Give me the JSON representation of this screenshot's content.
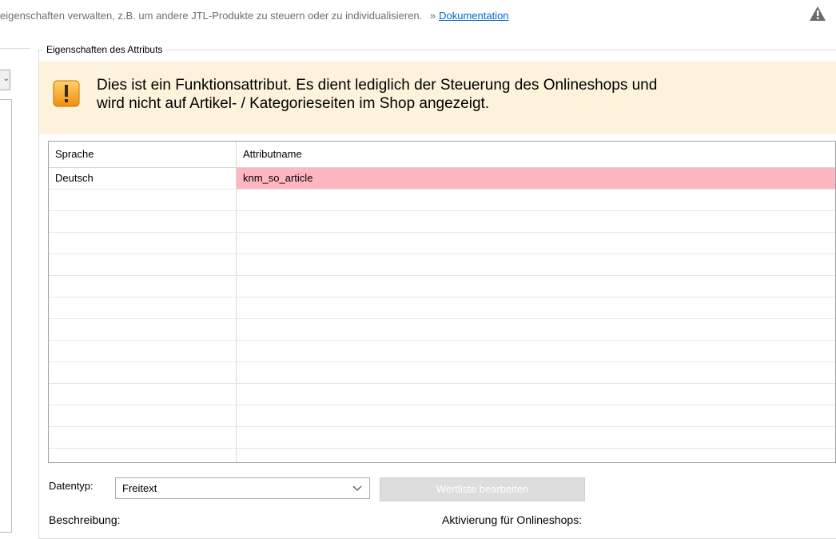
{
  "top": {
    "info_text": "eigenschaften verwalten, z.B. um andere JTL-Produkte zu steuern oder zu individualisieren.",
    "link_prefix": "»",
    "link_label": "Dokumentation",
    "warning_icon": "warning-triangle-icon"
  },
  "left": {
    "dropdown_glyph": "⌄"
  },
  "group": {
    "title": "Eigenschaften des Attributs"
  },
  "banner": {
    "icon": "exclamation-icon",
    "line1": "Dies ist ein Funktionsattribut. Es dient lediglich der Steuerung des Onlineshops und",
    "line2": "wird nicht auf Artikel- / Kategorieseiten im Shop angezeigt.",
    "background": "#fdf2db",
    "icon_color": "#f4a020"
  },
  "grid": {
    "headers": [
      "Sprache",
      "Attributname"
    ],
    "rows": [
      [
        "Deutsch",
        "knm_so_article"
      ]
    ],
    "highlight_color": "#ffb6c1"
  },
  "controls": {
    "datentyp_label": "Datentyp:",
    "datentyp_value": "Freitext",
    "wertliste_button": "Wertliste bearbeiten",
    "beschreibung_label": "Beschreibung:",
    "aktivierung_label": "Aktivierung für Onlineshops:"
  }
}
